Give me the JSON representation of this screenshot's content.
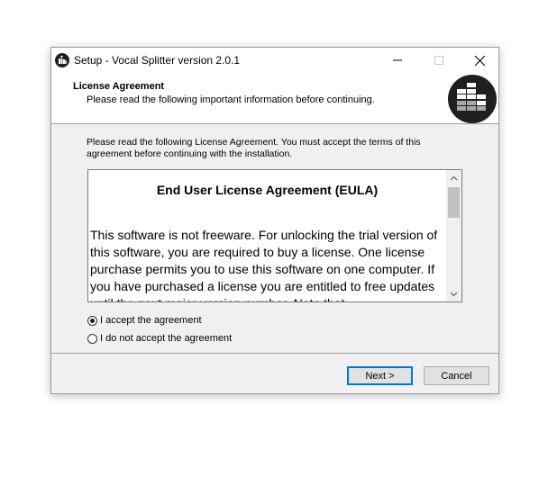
{
  "window": {
    "title": "Setup - Vocal Splitter version 2.0.1"
  },
  "header": {
    "title": "License Agreement",
    "subtitle": "Please read the following important information before continuing."
  },
  "intro": "Please read the following License Agreement. You must accept the terms of this agreement before continuing with the installation.",
  "eula": {
    "heading": "End User License Agreement (EULA)",
    "body": "This software is not freeware. For unlocking the trial version of this software, you are required to buy a license. One license purchase permits you to use this software on one computer. If you have purchased a license you are entitled to free updates until the next major version number. Note that"
  },
  "options": [
    {
      "label": "I accept the agreement",
      "checked": true
    },
    {
      "label": "I do not accept the agreement",
      "checked": false
    }
  ],
  "buttons": {
    "next": "Next >",
    "cancel": "Cancel"
  },
  "icons": {
    "app": "vocal-splitter-logo-icon",
    "minimize": "minimize-icon",
    "maximize": "maximize-icon",
    "close": "close-icon",
    "scroll_up": "chevron-up-icon",
    "scroll_down": "chevron-down-icon"
  },
  "colors": {
    "accent": "#0078d7",
    "logo_bg": "#1f1f1f"
  }
}
